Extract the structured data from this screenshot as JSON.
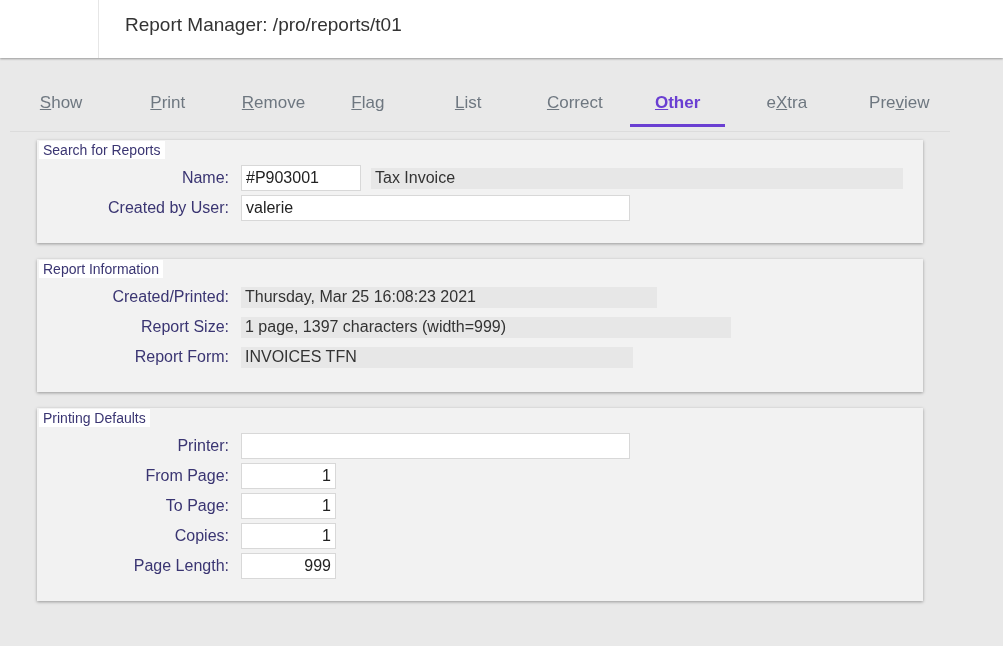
{
  "header": {
    "title": "Report Manager: /pro/reports/t01"
  },
  "tabs": [
    {
      "key": "S",
      "post": "how",
      "selected": false
    },
    {
      "key": "P",
      "post": "rint",
      "selected": false
    },
    {
      "key": "R",
      "post": "emove",
      "selected": false
    },
    {
      "key": "F",
      "post": "lag",
      "selected": false
    },
    {
      "key": "L",
      "post": "ist",
      "selected": false
    },
    {
      "key": "C",
      "post": "orrect",
      "selected": false
    },
    {
      "key": "O",
      "post": "ther",
      "selected": true
    },
    {
      "pre": "e",
      "key": "X",
      "post": "tra",
      "selected": false
    },
    {
      "pre": "Pre",
      "key": "v",
      "post": "iew",
      "selected": false
    }
  ],
  "sections": [
    {
      "title": "Search for Reports",
      "rows": [
        {
          "label": "Name:",
          "fields": [
            {
              "kind": "input",
              "value": "#P903001"
            },
            {
              "kind": "display",
              "value": "Tax Invoice"
            }
          ]
        },
        {
          "label": "Created by User:",
          "fields": [
            {
              "kind": "input",
              "value": "valerie"
            }
          ]
        }
      ]
    },
    {
      "title": "Report Information",
      "rows": [
        {
          "label": "Created/Printed:",
          "fields": [
            {
              "kind": "display",
              "value": "Thursday, Mar 25 16:08:23 2021"
            }
          ]
        },
        {
          "label": "Report Size:",
          "fields": [
            {
              "kind": "display",
              "value": "1 page, 1397 characters (width=999)"
            }
          ]
        },
        {
          "label": "Report Form:",
          "fields": [
            {
              "kind": "display",
              "value": "INVOICES TFN"
            }
          ]
        }
      ]
    },
    {
      "title": "Printing Defaults",
      "rows": [
        {
          "label": "Printer:",
          "fields": [
            {
              "kind": "input"
            }
          ]
        },
        {
          "label": "From Page:",
          "fields": [
            {
              "kind": "number",
              "value": "1"
            }
          ]
        },
        {
          "label": "To Page:",
          "fields": [
            {
              "kind": "number",
              "value": "1"
            }
          ]
        },
        {
          "label": "Copies:",
          "fields": [
            {
              "kind": "number",
              "value": "1"
            }
          ]
        },
        {
          "label": "Page Length:",
          "fields": [
            {
              "kind": "number",
              "value": "999"
            }
          ]
        }
      ]
    }
  ]
}
